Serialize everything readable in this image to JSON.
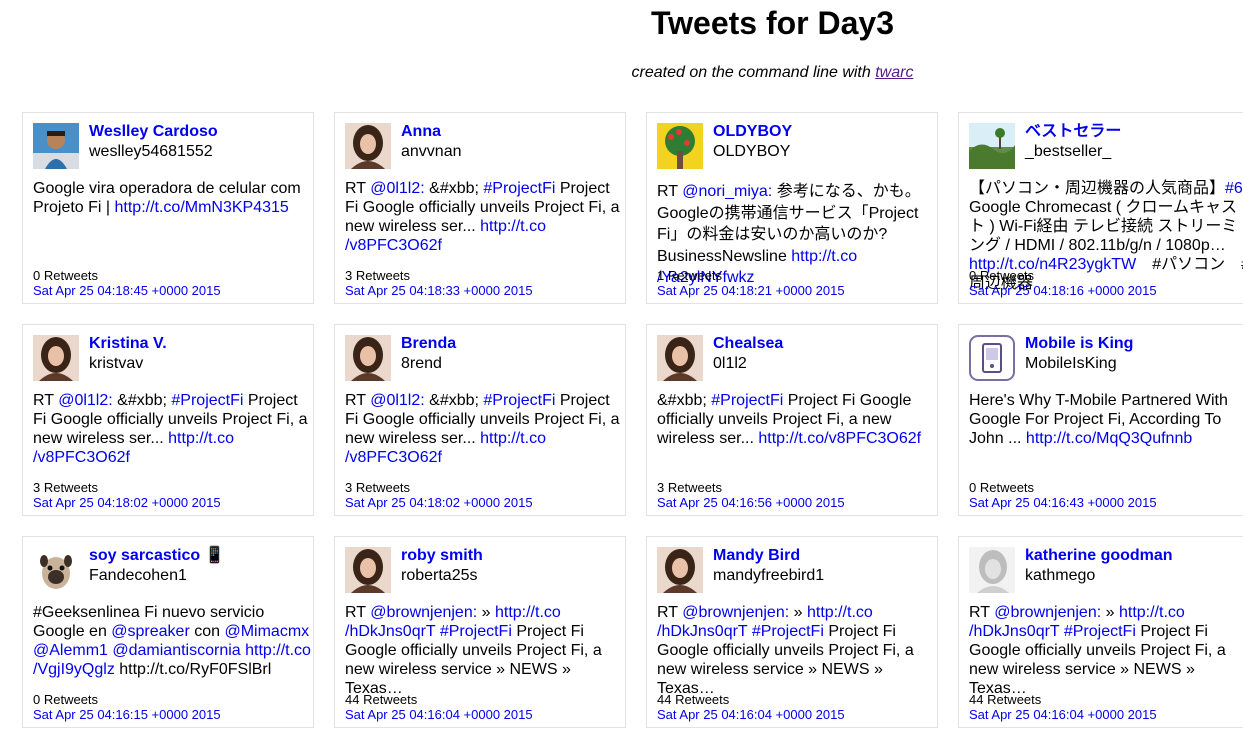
{
  "header": {
    "title": "Tweets for Day3",
    "subtitle_prefix": "created on the command line with ",
    "subtitle_link": "twarc"
  },
  "colors": {
    "link": "#0000ee",
    "visited_link": "#551a8b",
    "card_border": "#e3e3e3"
  },
  "tweets": [
    {
      "name": "Weslley Cardoso",
      "handle": "weslley54681552",
      "avatar": "avatar-photo-man",
      "segments": [
        {
          "t": "Google vira operadora de celular com Projeto Fi | "
        },
        {
          "t": "http://t.co/MmN3KP4315",
          "l": 1
        }
      ],
      "retweets": "0 Retweets",
      "date": "Sat Apr 25 04:18:45 +0000 2015"
    },
    {
      "name": "Anna",
      "handle": "anvvnan",
      "avatar": "avatar-photo-woman",
      "segments": [
        {
          "t": "RT "
        },
        {
          "t": "@0l1l2:",
          "l": 1
        },
        {
          "t": " &#xbb; "
        },
        {
          "t": "#ProjectFi",
          "l": 1
        },
        {
          "t": " Project Fi Google officially unveils Project Fi, a new wireless ser... "
        },
        {
          "t": "http://t.co /v8PFC3O62f",
          "l": 1
        }
      ],
      "retweets": "3 Retweets",
      "date": "Sat Apr 25 04:18:33 +0000 2015"
    },
    {
      "name": "OLDYBOY",
      "handle": "OLDYBOY",
      "avatar": "avatar-tree",
      "segments": [
        {
          "t": "RT "
        },
        {
          "t": "@nori_miya:",
          "l": 1
        },
        {
          "t": " 参考になる、かも。Googleの携帯通信サービス「Project Fi」の料金は安いのか高いのか? BusinessNewsline "
        },
        {
          "t": "http://t.co /Ya2ylNYfwkz",
          "l": 1
        }
      ],
      "retweets": "1 Retweets",
      "date": "Sat Apr 25 04:18:21 +0000 2015",
      "tall": true
    },
    {
      "name": "ベストセラー",
      "handle": "_bestseller_",
      "avatar": "avatar-landscape",
      "segments": [
        {
          "t": "【パソコン・周辺機器の人気商品】"
        },
        {
          "t": "#6:",
          "l": 1
        },
        {
          "t": " Google Chromecast ( クロームキャスト ) Wi-Fi経由 テレビ接続 ストリーミング / HDMI / 802.11b/g/n / 1080p… "
        },
        {
          "t": "http://t.co/n4R23ygkTW",
          "l": 1
        },
        {
          "t": "　#パソコン　#周辺機器"
        }
      ],
      "retweets": "0 Retweets",
      "date": "Sat Apr 25 04:18:16 +0000 2015"
    },
    {
      "name": "Kristina V.",
      "handle": "kristvav",
      "avatar": "avatar-photo-woman",
      "segments": [
        {
          "t": "RT "
        },
        {
          "t": "@0l1l2:",
          "l": 1
        },
        {
          "t": " &#xbb; "
        },
        {
          "t": "#ProjectFi",
          "l": 1
        },
        {
          "t": " Project Fi Google officially unveils Project Fi, a new wireless ser... "
        },
        {
          "t": "http://t.co /v8PFC3O62f",
          "l": 1
        }
      ],
      "retweets": "3 Retweets",
      "date": "Sat Apr 25 04:18:02 +0000 2015"
    },
    {
      "name": "Brenda",
      "handle": "8rend",
      "avatar": "avatar-photo-woman",
      "segments": [
        {
          "t": "RT "
        },
        {
          "t": "@0l1l2:",
          "l": 1
        },
        {
          "t": " &#xbb; "
        },
        {
          "t": "#ProjectFi",
          "l": 1
        },
        {
          "t": " Project Fi Google officially unveils Project Fi, a new wireless ser... "
        },
        {
          "t": "http://t.co /v8PFC3O62f",
          "l": 1
        }
      ],
      "retweets": "3 Retweets",
      "date": "Sat Apr 25 04:18:02 +0000 2015"
    },
    {
      "name": "Chealsea",
      "handle": "0l1l2",
      "avatar": "avatar-photo-woman",
      "segments": [
        {
          "t": "&#xbb; "
        },
        {
          "t": "#ProjectFi",
          "l": 1
        },
        {
          "t": " Project Fi Google officially unveils Project Fi, a new wireless ser... "
        },
        {
          "t": "http://t.co/v8PFC3O62f",
          "l": 1
        }
      ],
      "retweets": "3 Retweets",
      "date": "Sat Apr 25 04:16:56 +0000 2015"
    },
    {
      "name": "Mobile is King",
      "handle": "MobileIsKing",
      "avatar": "avatar-phone-icon",
      "segments": [
        {
          "t": "Here's Why T-Mobile Partnered With Google For Project Fi, According To John ... "
        },
        {
          "t": "http://t.co/MqQ3Qufnnb",
          "l": 1
        }
      ],
      "retweets": "0 Retweets",
      "date": "Sat Apr 25 04:16:43 +0000 2015"
    },
    {
      "name": "soy sarcastico 📱",
      "handle": "Fandecohen1",
      "avatar": "avatar-pug",
      "segments": [
        {
          "t": "#Geeksenlinea Fi nuevo servicio Google en "
        },
        {
          "t": "@spreaker",
          "l": 1
        },
        {
          "t": " con "
        },
        {
          "t": "@Mimacmx",
          "l": 1
        },
        {
          "t": " "
        },
        {
          "t": "@Alemm1",
          "l": 1
        },
        {
          "t": " "
        },
        {
          "t": "@damiantiscornia",
          "l": 1
        },
        {
          "t": " "
        },
        {
          "t": "http://t.co /VgjI9yQglz",
          "l": 1
        },
        {
          "t": " http://t.co/RyF0FSlBrl"
        }
      ],
      "retweets": "0 Retweets",
      "date": "Sat Apr 25 04:16:15 +0000 2015"
    },
    {
      "name": "roby smith",
      "handle": "roberta25s",
      "avatar": "avatar-photo-woman",
      "segments": [
        {
          "t": "RT "
        },
        {
          "t": "@brownjenjen:",
          "l": 1
        },
        {
          "t": " » "
        },
        {
          "t": "http://t.co /hDkJns0qrT",
          "l": 1
        },
        {
          "t": " "
        },
        {
          "t": "#ProjectFi",
          "l": 1
        },
        {
          "t": " Project Fi Google officially unveils Project Fi, a new wireless service » NEWS » Texas…"
        }
      ],
      "retweets": "44 Retweets",
      "date": "Sat Apr 25 04:16:04 +0000 2015"
    },
    {
      "name": "Mandy Bird",
      "handle": "mandyfreebird1",
      "avatar": "avatar-photo-woman",
      "segments": [
        {
          "t": "RT "
        },
        {
          "t": "@brownjenjen:",
          "l": 1
        },
        {
          "t": " » "
        },
        {
          "t": "http://t.co /hDkJns0qrT",
          "l": 1
        },
        {
          "t": " "
        },
        {
          "t": "#ProjectFi",
          "l": 1
        },
        {
          "t": " Project Fi Google officially unveils Project Fi, a new wireless service » NEWS » Texas…"
        }
      ],
      "retweets": "44 Retweets",
      "date": "Sat Apr 25 04:16:04 +0000 2015"
    },
    {
      "name": "katherine goodman",
      "handle": "kathmego",
      "avatar": "avatar-photo-woman-bw",
      "segments": [
        {
          "t": "RT "
        },
        {
          "t": "@brownjenjen:",
          "l": 1
        },
        {
          "t": " » "
        },
        {
          "t": "http://t.co /hDkJns0qrT",
          "l": 1
        },
        {
          "t": " "
        },
        {
          "t": "#ProjectFi",
          "l": 1
        },
        {
          "t": " Project Fi Google officially unveils Project Fi, a new wireless service » NEWS » Texas…"
        }
      ],
      "retweets": "44 Retweets",
      "date": "Sat Apr 25 04:16:04 +0000 2015"
    }
  ]
}
